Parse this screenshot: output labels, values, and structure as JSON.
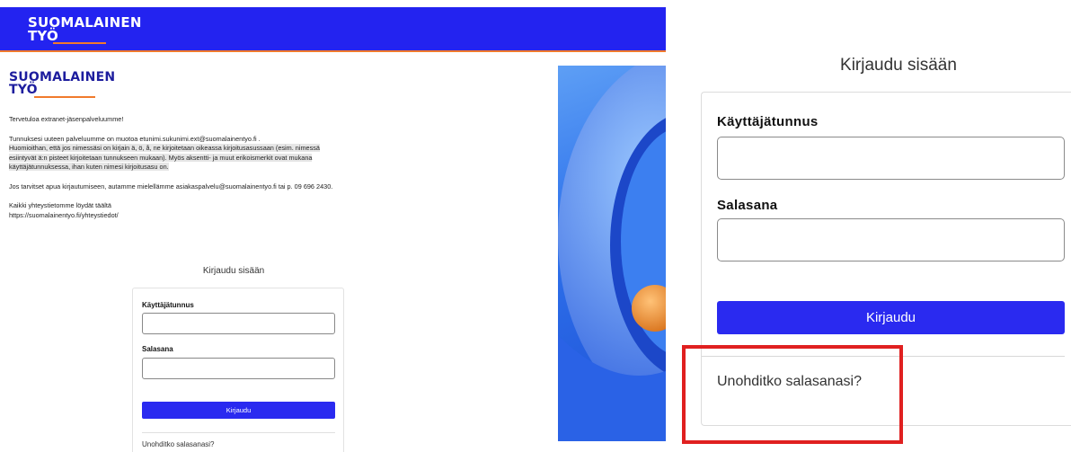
{
  "brand": {
    "line1": "SUOMALAINEN",
    "line2": "TYÖ",
    "primary_color": "#2323f0",
    "accent_color": "#f07a2c",
    "dark_blue": "#1d1d9e"
  },
  "intro": {
    "welcome": "Tervetuloa extranet-jäsenpalveluumme!",
    "username_format": "Tunnuksesi uuteen palveluumme on muotoa etunimi.sukunimi.ext@suomalainentyo.fi .",
    "note_line1": "Huomioithan, että jos nimessäsi on kirjain ä, ö, å, ne kirjoitetaan oikeassa kirjoitusasussaan (esim. nimessä",
    "note_line2": "esiintyvät ä:n pisteet kirjoitetaan tunnukseen mukaan). Myös aksentti- ja muut erikoismerkit ovat mukana",
    "note_line3": "käyttäjätunnuksessa, ihan kuten nimesi kirjoitusasu on.",
    "help": "Jos tarvitset apua kirjautumiseen, autamme mielellämme asiakaspalvelu@suomalainentyo.fi tai p. 09 696 2430.",
    "contacts_line1": "Kaikki yhteystietomme löydät täältä",
    "contacts_line2": "https://suomalainentyo.fi/yhteystiedot/"
  },
  "login": {
    "title": "Kirjaudu sisään",
    "username_label": "Käyttäjätunnus",
    "username_value": "",
    "password_label": "Salasana",
    "password_value": "",
    "submit_label": "Kirjaudu",
    "forgot_link": "Unohditko salasanasi?"
  },
  "annotation": {
    "highlight_color": "#e02020"
  }
}
